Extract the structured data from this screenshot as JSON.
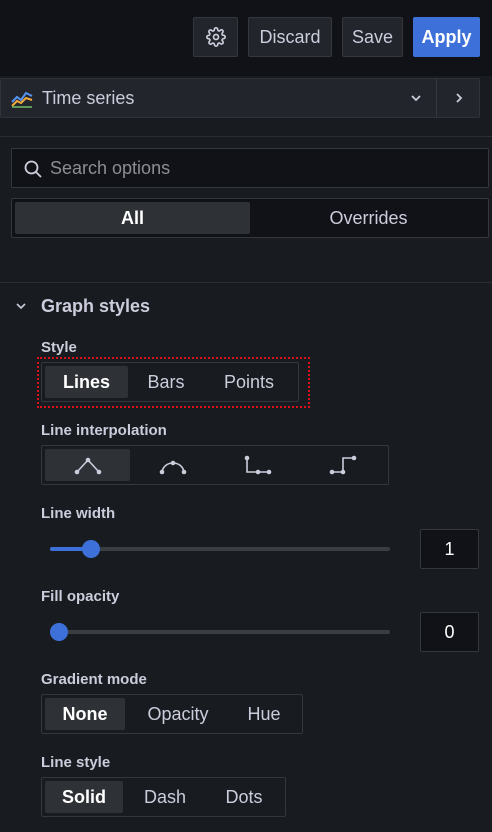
{
  "toolbar": {
    "settings_icon": "gear-icon",
    "discard_label": "Discard",
    "save_label": "Save",
    "apply_label": "Apply",
    "primary_color": "#3d71d9"
  },
  "visualization": {
    "icon": "time-series-icon",
    "label": "Time series"
  },
  "search": {
    "placeholder": "Search options",
    "value": ""
  },
  "tabs": [
    {
      "label": "All",
      "active": true
    },
    {
      "label": "Overrides",
      "active": false
    }
  ],
  "graph_styles": {
    "title": "Graph styles",
    "style": {
      "label": "Style",
      "options": [
        "Lines",
        "Bars",
        "Points"
      ],
      "selected": "Lines"
    },
    "line_interpolation": {
      "label": "Line interpolation",
      "options": [
        "linear-icon",
        "smooth-icon",
        "step-before-icon",
        "step-after-icon"
      ],
      "selected": "linear-icon"
    },
    "line_width": {
      "label": "Line width",
      "value": "1",
      "fraction": 0.1
    },
    "fill_opacity": {
      "label": "Fill opacity",
      "value": "0",
      "fraction": 0
    },
    "gradient_mode": {
      "label": "Gradient mode",
      "options": [
        "None",
        "Opacity",
        "Hue"
      ],
      "selected": "None"
    },
    "line_style": {
      "label": "Line style",
      "options": [
        "Solid",
        "Dash",
        "Dots"
      ],
      "selected": "Solid"
    }
  }
}
